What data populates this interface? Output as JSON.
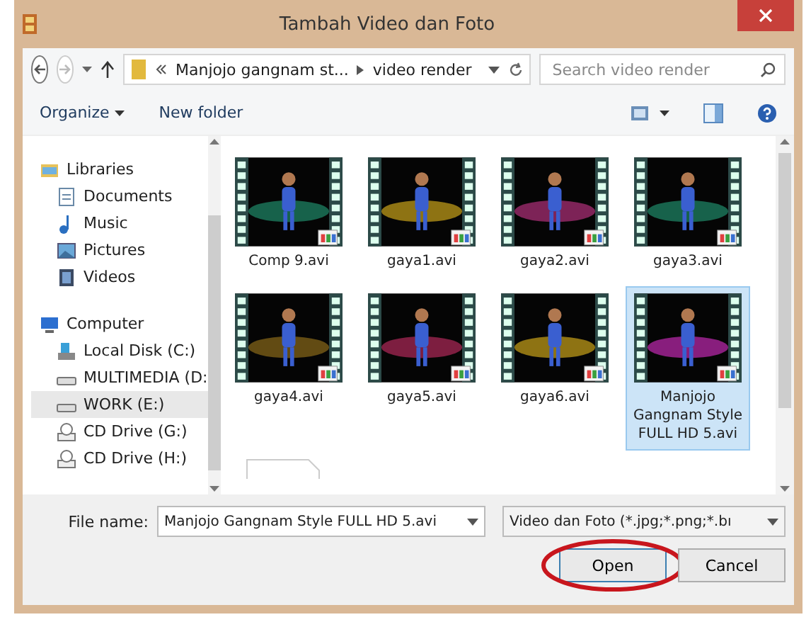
{
  "window": {
    "title": "Tambah Video dan Foto"
  },
  "address": {
    "crumbs": [
      "Manjojo gangnam st...",
      "video render"
    ],
    "search_placeholder": "Search video render"
  },
  "toolbar": {
    "organize": "Organize",
    "new_folder": "New folder"
  },
  "sidebar": [
    {
      "label": "Libraries",
      "kind": "libraries",
      "selected": false,
      "children": [
        {
          "label": "Documents",
          "kind": "documents",
          "selected": false
        },
        {
          "label": "Music",
          "kind": "music",
          "selected": false
        },
        {
          "label": "Pictures",
          "kind": "pictures",
          "selected": false
        },
        {
          "label": "Videos",
          "kind": "videos",
          "selected": false
        }
      ]
    },
    {
      "label": "Computer",
      "kind": "computer",
      "selected": false,
      "children": [
        {
          "label": "Local Disk (C:)",
          "kind": "system",
          "selected": false
        },
        {
          "label": "MULTIMEDIA (D:",
          "kind": "disk",
          "selected": false
        },
        {
          "label": "WORK (E:)",
          "kind": "disk",
          "selected": true
        },
        {
          "label": "CD Drive (G:)",
          "kind": "cd",
          "selected": false
        },
        {
          "label": "CD Drive (H:)",
          "kind": "cd",
          "selected": false
        }
      ]
    }
  ],
  "files": [
    {
      "name": "Comp 9.avi",
      "selected": false
    },
    {
      "name": "gaya1.avi",
      "selected": false
    },
    {
      "name": "gaya2.avi",
      "selected": false
    },
    {
      "name": "gaya3.avi",
      "selected": false
    },
    {
      "name": "gaya4.avi",
      "selected": false
    },
    {
      "name": "gaya5.avi",
      "selected": false
    },
    {
      "name": "gaya6.avi",
      "selected": false
    },
    {
      "name": "Manjojo Gangnam Style FULL HD 5.avi",
      "selected": true
    }
  ],
  "footer": {
    "file_name_label": "File name:",
    "file_name": "Manjojo Gangnam Style FULL HD 5.avi",
    "file_type": "Video dan Foto (*.jpg;*.png;*.bı",
    "buttons": [
      {
        "label": "Open",
        "highlighted": true
      },
      {
        "label": "Cancel",
        "highlighted": false
      }
    ]
  }
}
